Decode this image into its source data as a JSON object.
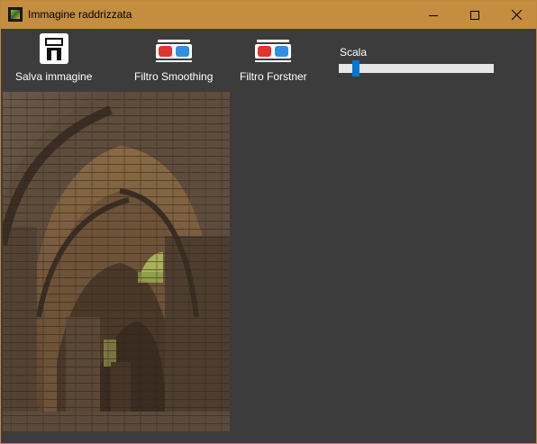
{
  "window": {
    "title": "Immagine raddrizzata"
  },
  "window_controls": {
    "minimize": "minimize-icon",
    "maximize": "maximize-icon",
    "close": "close-icon"
  },
  "toolbar": {
    "save_label": "Salva immagine",
    "smoothing_label": "Filtro Smoothing",
    "forstner_label": "Filtro Forstner",
    "scale_label": "Scala",
    "scale_value": 0.09
  },
  "colors": {
    "titlebar": "#c48d3f",
    "background": "#3c3c3c",
    "accent": "#0078d7",
    "glasses_red": "#e0342f",
    "glasses_blue": "#2f8fe0"
  },
  "icons": {
    "save": "floppy-disk-icon",
    "smoothing": "3d-glasses-icon",
    "forstner": "3d-glasses-icon"
  }
}
